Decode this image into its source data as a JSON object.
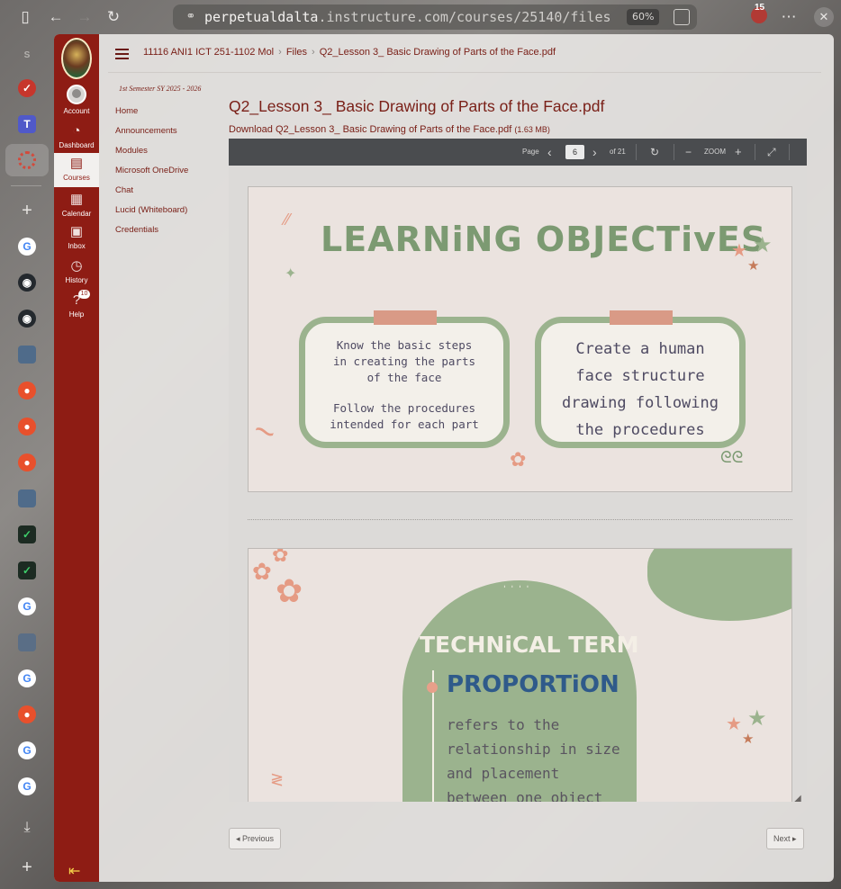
{
  "browser": {
    "url_host": "perpetualdalta",
    "url_domain": ".instructure.com",
    "url_path": "/courses/25140/files",
    "zoom": "60%",
    "extension_count": "15"
  },
  "global_nav": {
    "account": "Account",
    "dashboard": "Dashboard",
    "courses": "Courses",
    "calendar": "Calendar",
    "inbox": "Inbox",
    "history": "History",
    "help": "Help",
    "help_badge": "10"
  },
  "breadcrumbs": {
    "course": "11116 ANI1 ICT 251-1102 Mol",
    "section": "Files",
    "file": "Q2_Lesson 3_ Basic Drawing of Parts of the Face.pdf"
  },
  "course_nav": {
    "term": "1st Semester SY 2025 - 2026",
    "items": [
      "Home",
      "Announcements",
      "Modules",
      "Microsoft OneDrive",
      "Chat",
      "Lucid (Whiteboard)",
      "Credentials"
    ]
  },
  "content": {
    "title": "Q2_Lesson 3_ Basic Drawing of Parts of the Face.pdf",
    "download_label": "Download Q2_Lesson 3_ Basic Drawing of Parts of the Face.pdf",
    "download_size": "(1.63 MB)"
  },
  "viewer": {
    "page_label": "Page",
    "current_page": "6",
    "page_total": "of 21",
    "zoom_label": "ZOOM"
  },
  "slide1": {
    "title": "LEARNiNG OBJECTivES",
    "card1_line1": "Know the basic steps",
    "card1_line2": "in creating the parts",
    "card1_line3": "of the face",
    "card1_line4": "Follow the procedures",
    "card1_line5": "intended for each part",
    "card2_line1": "Create a human",
    "card2_line2": "face structure",
    "card2_line3": "drawing following",
    "card2_line4": "the procedures"
  },
  "slide2": {
    "heading": "TECHNiCAL TERM",
    "term": "PROPORTiON",
    "body1": "refers to the",
    "body2": "relationship in size",
    "body3": "and placement",
    "body4": "between one object"
  },
  "pager": {
    "previous": "◂ Previous",
    "next": "Next ▸"
  },
  "colors": {
    "canvas_red": "#8e1c14",
    "link": "#7a2018",
    "sage": "#9bb38e",
    "peach": "#d99a86"
  }
}
